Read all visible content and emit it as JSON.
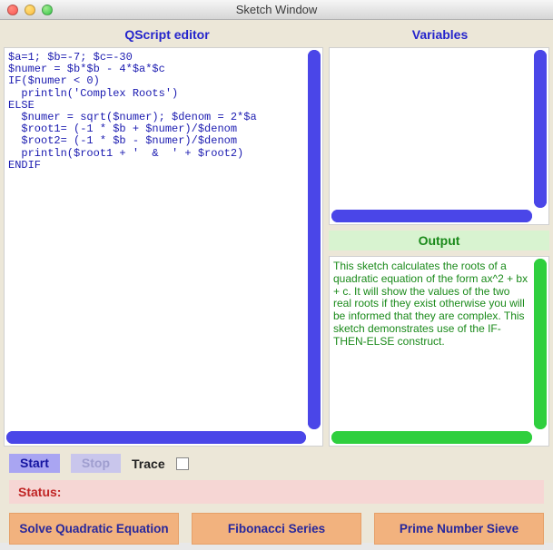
{
  "window": {
    "title": "Sketch Window"
  },
  "headers": {
    "editor": "QScript editor",
    "variables": "Variables",
    "output": "Output"
  },
  "code": "$a=1; $b=-7; $c=-30\n$numer = $b*$b - 4*$a*$c\nIF($numer < 0)\n  println('Complex Roots')\nELSE\n  $numer = sqrt($numer); $denom = 2*$a\n  $root1= (-1 * $b + $numer)/$denom\n  $root2= (-1 * $b - $numer)/$denom\n  println($root1 + '  &  ' + $root2)\nENDIF",
  "output_text": "This sketch calculates the roots of a quadratic equation of the form ax^2 + bx + c. It will show the values of the two real roots if they exist otherwise you will  be informed that they are complex. This sketch demonstrates use of the IF-THEN-ELSE construct.",
  "controls": {
    "start": "Start",
    "stop": "Stop",
    "trace": "Trace",
    "status_label": "Status:",
    "status_value": ""
  },
  "buttons": {
    "b1": "Solve Quadratic Equation",
    "b2": "Fibonacci Series",
    "b3": "Prime Number Sieve"
  }
}
